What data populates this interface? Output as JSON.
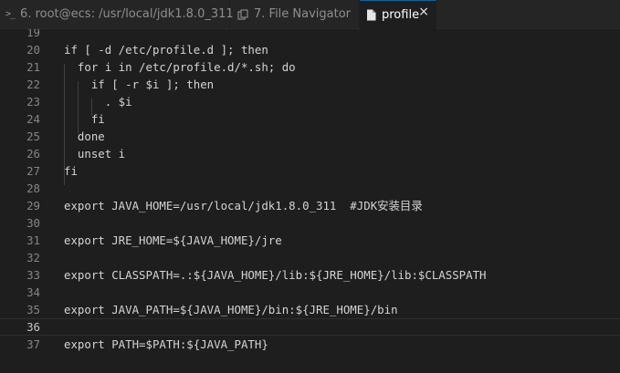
{
  "tabs": [
    {
      "label": "6. root@ecs: /usr/local/jdk1.8.0_311",
      "icon": "terminal-icon",
      "active": false
    },
    {
      "label": "7. File Navigator",
      "icon": "file-navigator-icon",
      "active": false
    },
    {
      "label": "profile",
      "icon": "file-icon",
      "active": true
    }
  ],
  "close_glyph": "×",
  "editor": {
    "current_line": 36,
    "lines": [
      {
        "num": "19",
        "text": ""
      },
      {
        "num": "20",
        "text": "if [ -d /etc/profile.d ]; then"
      },
      {
        "num": "21",
        "text": "  for i in /etc/profile.d/*.sh; do"
      },
      {
        "num": "22",
        "text": "    if [ -r $i ]; then"
      },
      {
        "num": "23",
        "text": "      . $i"
      },
      {
        "num": "24",
        "text": "    fi"
      },
      {
        "num": "25",
        "text": "  done"
      },
      {
        "num": "26",
        "text": "  unset i"
      },
      {
        "num": "27",
        "text": "fi"
      },
      {
        "num": "28",
        "text": ""
      },
      {
        "num": "29",
        "text": "export JAVA_HOME=/usr/local/jdk1.8.0_311  #JDK安装目录"
      },
      {
        "num": "30",
        "text": ""
      },
      {
        "num": "31",
        "text": "export JRE_HOME=${JAVA_HOME}/jre"
      },
      {
        "num": "32",
        "text": ""
      },
      {
        "num": "33",
        "text": "export CLASSPATH=.:${JAVA_HOME}/lib:${JRE_HOME}/lib:$CLASSPATH"
      },
      {
        "num": "34",
        "text": ""
      },
      {
        "num": "35",
        "text": "export JAVA_PATH=${JAVA_HOME}/bin:${JRE_HOME}/bin"
      },
      {
        "num": "36",
        "text": ""
      },
      {
        "num": "37",
        "text": "export PATH=$PATH:${JAVA_PATH}"
      }
    ]
  },
  "colors": {
    "background": "#1e1e1e",
    "tabbar": "#252526",
    "text": "#d4d4d4",
    "line_number": "#858585",
    "active_tab_text": "#ffffff"
  }
}
